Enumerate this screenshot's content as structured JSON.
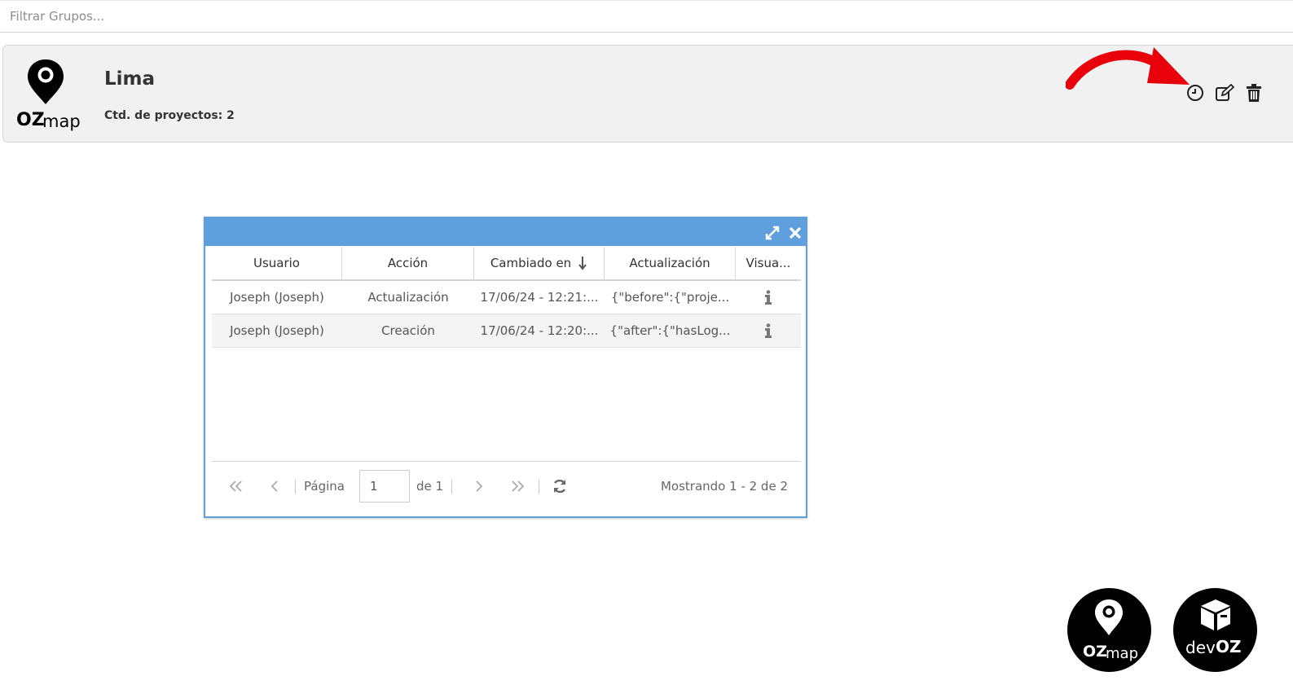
{
  "filter": {
    "placeholder": "Filtrar Grupos..."
  },
  "group": {
    "logo_text_bold": "OZ",
    "logo_text_light": "map",
    "title": "Lima",
    "count_label": "Ctd. de proyectos: 2",
    "actions": [
      "history-icon",
      "edit-icon",
      "trash-icon"
    ]
  },
  "dialog": {
    "columns": [
      "Usuario",
      "Acción",
      "Cambiado en",
      "Actualización",
      "Visua..."
    ],
    "rows": [
      {
        "usuario": "Joseph (Joseph)",
        "accion": "Actualización",
        "fecha": "17/06/24 - 12:21:...",
        "actualizacion": "{\"before\":{\"proje...",
        "icon": "info-icon"
      },
      {
        "usuario": "Joseph (Joseph)",
        "accion": "Creación",
        "fecha": "17/06/24 - 12:20:...",
        "actualizacion": "{\"after\":{\"hasLog...",
        "icon": "info-icon"
      }
    ],
    "pager": {
      "page_label": "Página",
      "page_value": "1",
      "of_label": "de 1",
      "info": "Mostrando 1 - 2 de 2"
    }
  },
  "badges": {
    "ozmap": {
      "bold": "OZ",
      "light": "map"
    },
    "devoz": {
      "light": "dev",
      "bold": "OZ"
    }
  },
  "colors": {
    "header_blue": "#5f9fdd",
    "annotation_red": "#e8000b"
  }
}
